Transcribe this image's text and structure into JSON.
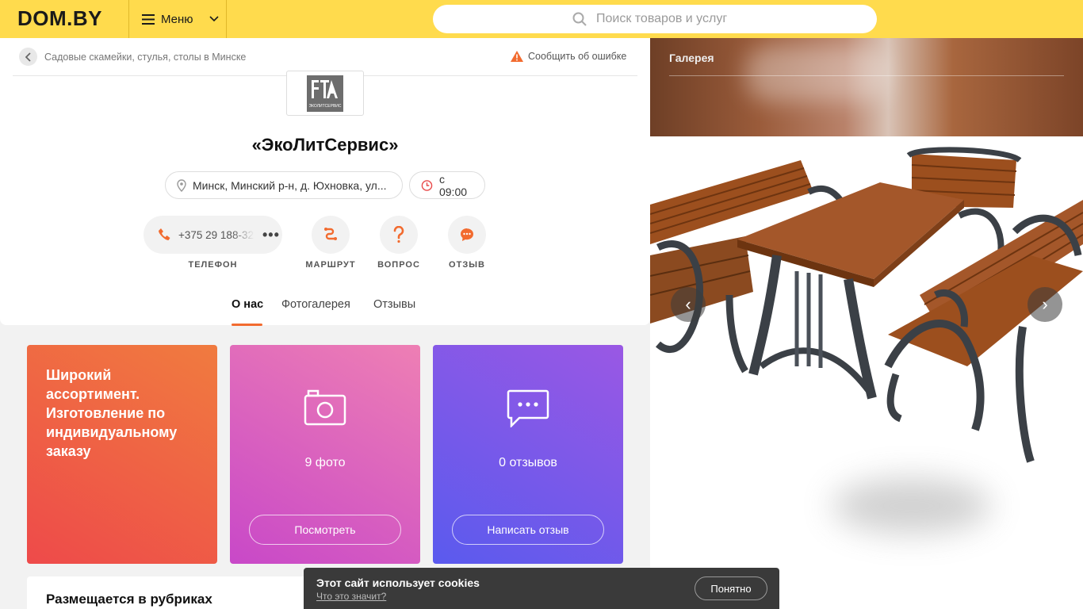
{
  "header": {
    "logo": "DOM.BY",
    "menu_label": "Меню",
    "search_placeholder": "Поиск товаров и услуг"
  },
  "breadcrumb": {
    "label": "Садовые скамейки, стулья, столы в Минске"
  },
  "report_error": "Сообщить об ошибке",
  "company": {
    "logo_caption": "ЭКОЛИТСЕРВИС",
    "name": "«ЭкоЛитСервис»",
    "address": "Минск, Минский р-н, д. Юхновка, ул...",
    "hours": "с 09:00",
    "phone": "+375 29 188-32"
  },
  "actions": {
    "phone_label": "ТЕЛЕФОН",
    "route_label": "МАРШРУТ",
    "question_label": "ВОПРОС",
    "review_label": "ОТЗЫВ"
  },
  "tabs": {
    "about": "О нас",
    "gallery": "Фотогалерея",
    "reviews": "Отзывы"
  },
  "cards": {
    "assortment_text": "Широкий ассортимент. Изготовление по индивидуальному заказу",
    "photos_count": "9 фото",
    "photos_button": "Посмотреть",
    "reviews_count": "0 отзывов",
    "reviews_button": "Написать отзыв"
  },
  "rubrics": {
    "title": "Размещается в рубриках"
  },
  "gallery": {
    "title": "Галерея"
  },
  "cookie": {
    "title": "Этот сайт использует cookies",
    "link": "Что это значит?",
    "accept": "Понятно"
  },
  "colors": {
    "brand_yellow": "#ffdb4d",
    "accent_orange": "#f26b2f"
  }
}
